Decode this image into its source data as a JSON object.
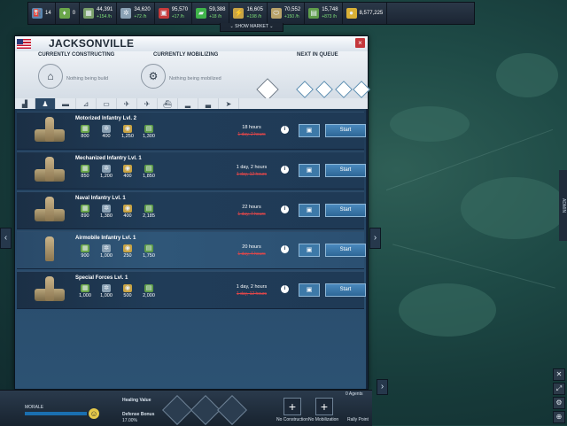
{
  "resources": [
    {
      "icon": "fuel-icon",
      "color": "#5b86b0",
      "value": "14",
      "rate": "",
      "glyph": "⛽"
    },
    {
      "icon": "supplies-icon",
      "color": "#6aa64a",
      "value": "0",
      "rate": "",
      "glyph": "♦"
    },
    {
      "icon": "components-icon",
      "color": "#7aa06a",
      "value": "44,391",
      "rate": "+154 /h",
      "glyph": "▦"
    },
    {
      "icon": "electronics-icon",
      "color": "#8aa1b4",
      "value": "34,620",
      "rate": "+72 /h",
      "glyph": "✲"
    },
    {
      "icon": "rare-materials-icon",
      "color": "#c73a3a",
      "value": "95,570",
      "rate": "+17 /h",
      "glyph": "▣"
    },
    {
      "icon": "manpower-icon",
      "color": "#3fb34a",
      "value": "59,388",
      "rate": "+18 /h",
      "glyph": "▰"
    },
    {
      "icon": "metals-icon",
      "color": "#c9a444",
      "value": "16,605",
      "rate": "+198 /h",
      "glyph": "⚡"
    },
    {
      "icon": "food-icon",
      "color": "#b9a36a",
      "value": "70,552",
      "rate": "+150 /h",
      "glyph": "⬭"
    },
    {
      "icon": "money-icon",
      "color": "#5f9d4a",
      "value": "15,748",
      "rate": "+873 /h",
      "glyph": "▤"
    },
    {
      "icon": "gold-icon",
      "color": "#d9b036",
      "value": "8,577,225",
      "rate": "",
      "glyph": "●"
    }
  ],
  "show_market": "SHOW MARKET",
  "city": {
    "name": "JACKSONVILLE",
    "close": "×"
  },
  "status": {
    "constructing_label": "CURRENTLY CONSTRUCTING",
    "constructing_value": "Nothing being build",
    "mobilizing_label": "CURRENTLY MOBILIZING",
    "mobilizing_value": "Nothing being mobilized",
    "queue_label": "NEXT IN QUEUE"
  },
  "tabs": [
    {
      "icon": "building-icon",
      "glyph": "▟"
    },
    {
      "icon": "infantry-icon",
      "glyph": "♟"
    },
    {
      "icon": "tank-icon",
      "glyph": "▬"
    },
    {
      "icon": "artillery-icon",
      "glyph": "⊿"
    },
    {
      "icon": "truck-icon",
      "glyph": "▭"
    },
    {
      "icon": "helicopter-icon",
      "glyph": "✈"
    },
    {
      "icon": "jet-icon",
      "glyph": "✈"
    },
    {
      "icon": "ship-icon",
      "glyph": "⛴"
    },
    {
      "icon": "submarine-icon",
      "glyph": "▂"
    },
    {
      "icon": "carrier-icon",
      "glyph": "▃"
    },
    {
      "icon": "missile-icon",
      "glyph": "➤"
    }
  ],
  "units": [
    {
      "name": "Motorized Infantry Lvl. 2",
      "costs": [
        "800",
        "400",
        "1,250",
        "1,300"
      ],
      "time": "18 hours",
      "old_time": "1 day, 2 hours",
      "start": "Start",
      "vehicle": true
    },
    {
      "name": "Mechanized Infantry Lvl. 1",
      "costs": [
        "850",
        "1,200",
        "400",
        "1,850"
      ],
      "time": "1 day, 2 hours",
      "old_time": "1 day, 12 hours",
      "start": "Start",
      "vehicle": true
    },
    {
      "name": "Naval Infantry Lvl. 1",
      "costs": [
        "890",
        "1,380",
        "400",
        "2,185"
      ],
      "time": "22 hours",
      "old_time": "1 day, 7 hours",
      "start": "Start",
      "vehicle": true
    },
    {
      "name": "Airmobile Infantry Lvl. 1",
      "costs": [
        "900",
        "1,000",
        "250",
        "1,750"
      ],
      "time": "20 hours",
      "old_time": "1 day, 4 hours",
      "start": "Start",
      "vehicle": false
    },
    {
      "name": "Special Forces Lvl. 1",
      "costs": [
        "1,000",
        "1,000",
        "500",
        "2,000"
      ],
      "time": "1 day, 2 hours",
      "old_time": "1 day, 12 hours",
      "start": "Start",
      "vehicle": true
    }
  ],
  "cost_icons": [
    {
      "icon": "supplies-cost-icon",
      "color": "#6aa64a",
      "glyph": "▦"
    },
    {
      "icon": "components-cost-icon",
      "color": "#8aa1b4",
      "glyph": "✲"
    },
    {
      "icon": "metals-cost-icon",
      "color": "#c9a444",
      "glyph": "◉"
    },
    {
      "icon": "money-cost-icon",
      "color": "#5f9d4a",
      "glyph": "▤"
    }
  ],
  "bottom": {
    "morale": "MORALE",
    "healing": "Healing Value",
    "defense": "Defense Bonus",
    "defense_value": "17.00%",
    "no_construction": "No Construction",
    "no_mobilization": "No Mobilization",
    "rally_point": "Rally Point",
    "agents": "0 Agents"
  },
  "side": {
    "admin": "ADMIN"
  }
}
